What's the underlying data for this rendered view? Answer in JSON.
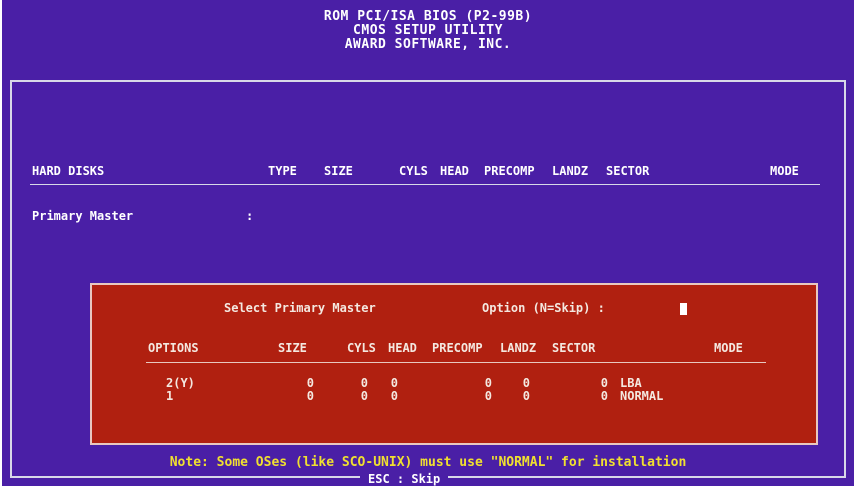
{
  "header": {
    "line1": "ROM PCI/ISA BIOS (P2-99B)",
    "line2": "CMOS SETUP UTILITY",
    "line3": "AWARD SOFTWARE, INC."
  },
  "table": {
    "columns": [
      "HARD DISKS",
      "TYPE",
      "SIZE",
      "CYLS",
      "HEAD",
      "PRECOMP",
      "LANDZ",
      "SECTOR",
      "MODE"
    ],
    "row_label": "Primary Master",
    "row_sep": ":"
  },
  "dialog": {
    "prompt": "Select Primary Master",
    "option_prompt": "Option (N=Skip) :",
    "columns": [
      "OPTIONS",
      "SIZE",
      "CYLS",
      "HEAD",
      "PRECOMP",
      "LANDZ",
      "SECTOR",
      "MODE"
    ],
    "rows": [
      {
        "option": "2(Y)",
        "size": "0",
        "cyls": "0",
        "head": "0",
        "precomp": "0",
        "landz": "0",
        "sector": "0",
        "mode": "LBA"
      },
      {
        "option": "1",
        "size": "0",
        "cyls": "0",
        "head": "0",
        "precomp": "0",
        "landz": "0",
        "sector": "0",
        "mode": "NORMAL"
      }
    ]
  },
  "note": "Note: Some OSes (like SCO-UNIX) must use \"NORMAL\" for installation",
  "footer": "ESC : Skip",
  "colors": {
    "background": "#4a1fa6",
    "dialog": "#b02010",
    "note": "#f0e030"
  }
}
